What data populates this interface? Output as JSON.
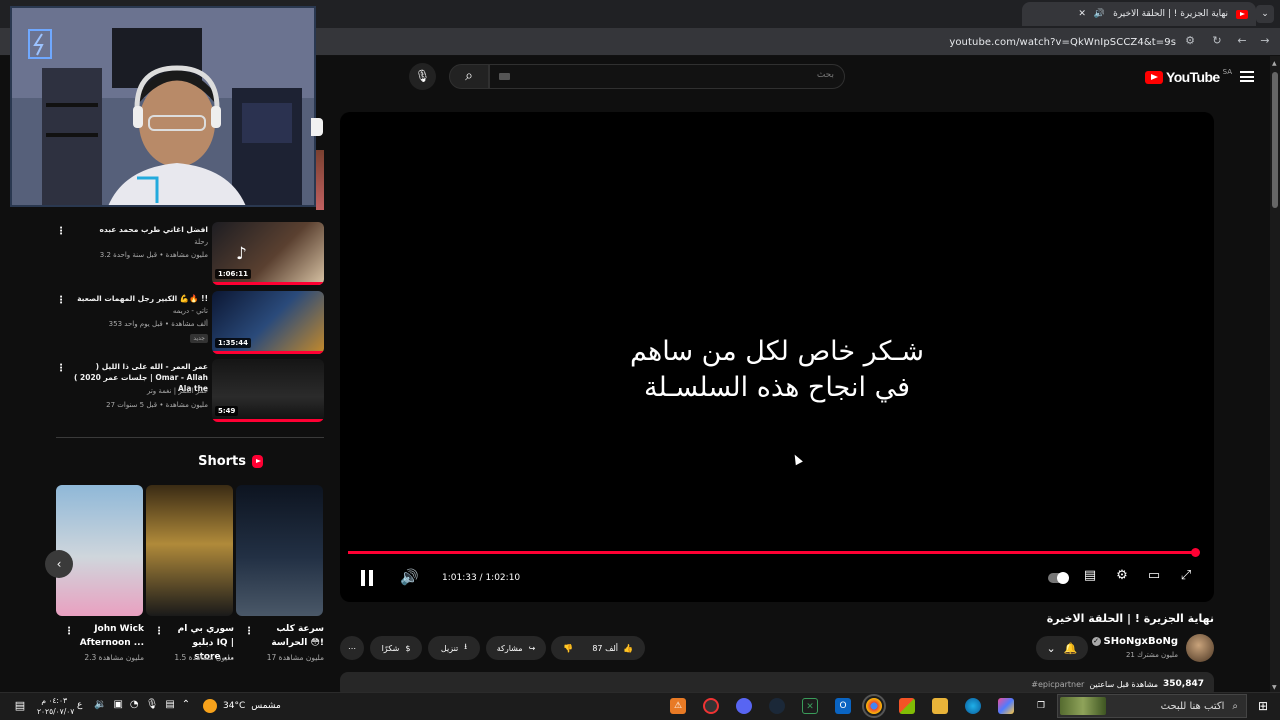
{
  "browser": {
    "tab_title": "نهاية الجزيرة ! | الحلقة الاخيرة",
    "tab_close": "✕",
    "new_tab": "+",
    "tab_menu": "⌄",
    "url": "youtube.com/watch?v=QkWnIpSCCZ4&t=9s"
  },
  "header": {
    "logo_text": "YouTube",
    "logo_region": "SA",
    "search_placeholder": "بحث"
  },
  "player": {
    "caption_line1": "شـكر خاص لكل من ساهم",
    "caption_line2": "في انجاح هذه السلسـلة",
    "time": "1:01:33 / 1:02:10",
    "progress": 0.99
  },
  "video": {
    "title": "نهاية الجزيرة ! | الحلقة الاخيرة",
    "channel_name": "SHoNgxBoNg",
    "subscribers": "21 مليون مشترك",
    "like_count": "87 ألف",
    "share_label": "مشاركة",
    "download_label": "تنزيل",
    "thanks_label": "شكرًا",
    "views": "350,847",
    "views_suffix": "مشاهدة قبل ساعتين",
    "hashtag": "#epicpartner"
  },
  "recommendations": [
    {
      "title": "افضل اغاني طرب محمد عبده",
      "channel": "رحلة",
      "meta": "3.2 مليون مشاهدة • قبل سنة واحدة",
      "duration": "1:06:11",
      "badge": ""
    },
    {
      "title": "الكبير رجل المهمات الصعبة 💪🔥 !!",
      "channel": "تاتي - دريمه",
      "meta": "353 ألف مشاهدة • قبل يوم واحد",
      "duration": "1:35:44",
      "badge": "جديد"
    },
    {
      "title": "عمر العمر - الله على ذا الليل ( جلسات عمر 2020 ) | Omar - Allah Ala the",
      "channel": "عمر العمر | نغمة وتر",
      "meta": "27 مليون مشاهدة • قبل 5 سنوات",
      "duration": "5:49",
      "badge": ""
    }
  ],
  "shorts": {
    "heading": "Shorts",
    "items": [
      {
        "title": "John Wick Afternoon ...",
        "views": "2.3 مليون مشاهدة"
      },
      {
        "title": "سوري بي ام دبليو IQ | store ...",
        "views": "1.5 مليون مشاهدة"
      },
      {
        "title": "سرعة كلب الحراسة 😳!",
        "views": "17 مليون مشاهدة"
      }
    ]
  },
  "taskbar": {
    "search_placeholder": "اكتب هنا للبحث",
    "weather_temp": "34°C",
    "weather_label": "مشمس",
    "time": "٠٤:٠٣ م",
    "date": "٢٠٢٥/٠٧/٠٧",
    "lang": "ع"
  }
}
